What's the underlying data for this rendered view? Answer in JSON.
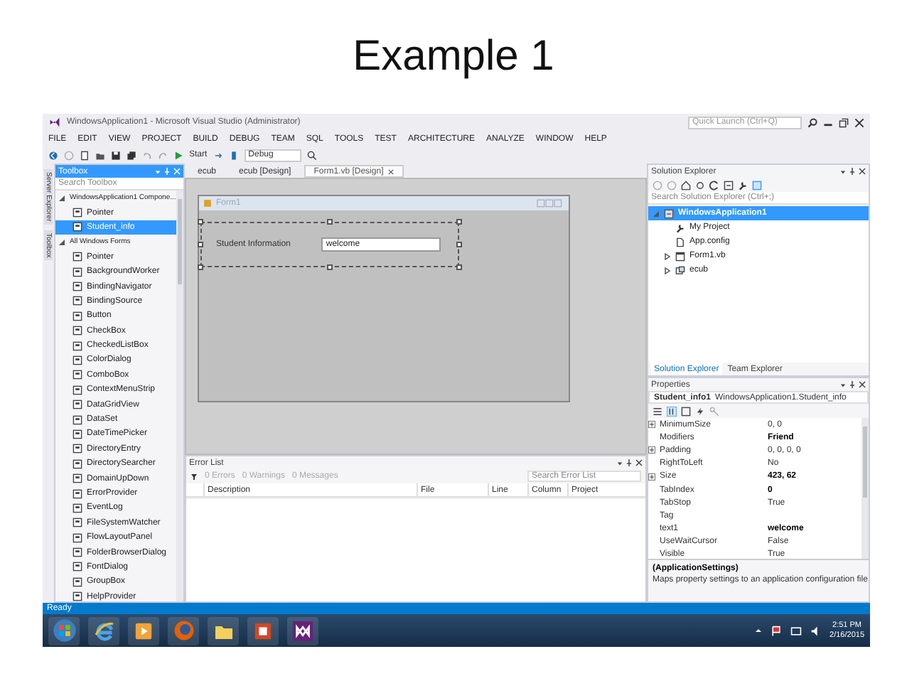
{
  "slide_title": "Example 1",
  "window": {
    "title": "WindowsApplication1 - Microsoft Visual Studio (Administrator)",
    "quick_launch": {
      "placeholder": "Quick Launch (Ctrl+Q)"
    }
  },
  "menu": [
    "FILE",
    "EDIT",
    "VIEW",
    "PROJECT",
    "BUILD",
    "DEBUG",
    "TEAM",
    "SQL",
    "TOOLS",
    "TEST",
    "ARCHITECTURE",
    "ANALYZE",
    "WINDOW",
    "HELP"
  ],
  "toolbar": {
    "start": "Start",
    "configuration": "Debug"
  },
  "side_rail": [
    "Server Explorer",
    "Toolbox"
  ],
  "toolbox": {
    "title": "Toolbox",
    "search": {
      "placeholder": "Search Toolbox"
    },
    "groups": [
      {
        "label": "WindowsApplication1 Compone...",
        "expanded": true,
        "items": [
          {
            "label": "Pointer",
            "selected": false
          },
          {
            "label": "Student_info",
            "selected": true
          }
        ]
      },
      {
        "label": "All Windows Forms",
        "expanded": true,
        "items": [
          {
            "label": "Pointer",
            "selected": false
          },
          {
            "label": "BackgroundWorker",
            "selected": false
          },
          {
            "label": "BindingNavigator",
            "selected": false
          },
          {
            "label": "BindingSource",
            "selected": false
          },
          {
            "label": "Button",
            "selected": false
          },
          {
            "label": "CheckBox",
            "selected": false
          },
          {
            "label": "CheckedListBox",
            "selected": false
          },
          {
            "label": "ColorDialog",
            "selected": false
          },
          {
            "label": "ComboBox",
            "selected": false
          },
          {
            "label": "ContextMenuStrip",
            "selected": false
          },
          {
            "label": "DataGridView",
            "selected": false
          },
          {
            "label": "DataSet",
            "selected": false
          },
          {
            "label": "DateTimePicker",
            "selected": false
          },
          {
            "label": "DirectoryEntry",
            "selected": false
          },
          {
            "label": "DirectorySearcher",
            "selected": false
          },
          {
            "label": "DomainUpDown",
            "selected": false
          },
          {
            "label": "ErrorProvider",
            "selected": false
          },
          {
            "label": "EventLog",
            "selected": false
          },
          {
            "label": "FileSystemWatcher",
            "selected": false
          },
          {
            "label": "FlowLayoutPanel",
            "selected": false
          },
          {
            "label": "FolderBrowserDialog",
            "selected": false
          },
          {
            "label": "FontDialog",
            "selected": false
          },
          {
            "label": "GroupBox",
            "selected": false
          },
          {
            "label": "HelpProvider",
            "selected": false
          }
        ]
      }
    ]
  },
  "document_tabs": [
    {
      "label": "ecub",
      "selected": false
    },
    {
      "label": "ecub [Design]",
      "selected": false
    },
    {
      "label": "Form1.vb [Design]",
      "selected": true
    }
  ],
  "designer": {
    "form_title": "Form1",
    "control_label": "Student Information",
    "textbox_value": "welcome"
  },
  "error_list": {
    "title": "Error List",
    "filters": [
      "0 Errors",
      "0 Warnings",
      "0 Messages"
    ],
    "search": {
      "placeholder": "Search Error List"
    },
    "columns": [
      "Description",
      "File",
      "Line",
      "Column",
      "Project"
    ]
  },
  "solution_explorer": {
    "title": "Solution Explorer",
    "search": {
      "placeholder": "Search Solution Explorer (Ctrl+;)"
    },
    "tree": [
      {
        "label": "WindowsApplication1",
        "kind": "solution",
        "selected": true,
        "expanded": true,
        "children": [
          {
            "label": "My Project",
            "kind": "wrench",
            "selected": false
          },
          {
            "label": "App.config",
            "kind": "file",
            "selected": false
          },
          {
            "label": "Form1.vb",
            "kind": "form",
            "selected": false,
            "expanded": false
          },
          {
            "label": "ecub",
            "kind": "control",
            "selected": false,
            "expanded": false
          }
        ]
      }
    ],
    "tabs": [
      {
        "label": "Solution Explorer",
        "selected": true
      },
      {
        "label": "Team Explorer",
        "selected": false
      }
    ]
  },
  "properties": {
    "title": "Properties",
    "object": {
      "name": "Student_info1",
      "type": "WindowsApplication1.Student_info"
    },
    "rows": [
      {
        "name": "MinimumSize",
        "value": "0, 0",
        "expandable": true,
        "modified": false
      },
      {
        "name": "Modifiers",
        "value": "Friend",
        "expandable": false,
        "modified": true
      },
      {
        "name": "Padding",
        "value": "0, 0, 0, 0",
        "expandable": true,
        "modified": false
      },
      {
        "name": "RightToLeft",
        "value": "No",
        "expandable": false,
        "modified": false
      },
      {
        "name": "Size",
        "value": "423, 62",
        "expandable": true,
        "modified": true
      },
      {
        "name": "TabIndex",
        "value": "0",
        "expandable": false,
        "modified": true
      },
      {
        "name": "TabStop",
        "value": "True",
        "expandable": false,
        "modified": false
      },
      {
        "name": "Tag",
        "expandable": false
      },
      {
        "name": "text1",
        "value": "welcome",
        "expandable": false,
        "modified": true
      },
      {
        "name": "UseWaitCursor",
        "value": "False",
        "expandable": false,
        "modified": false
      },
      {
        "name": "Visible",
        "value": "True",
        "expandable": false,
        "modified": false
      }
    ],
    "description": {
      "title": "(ApplicationSettings)",
      "text": "Maps property settings to an application configuration file."
    }
  },
  "status_bar": {
    "text": "Ready"
  },
  "taskbar": {
    "apps": [
      {
        "kind": "start"
      },
      {
        "kind": "browser"
      },
      {
        "kind": "media"
      },
      {
        "kind": "firefox"
      },
      {
        "kind": "folder"
      },
      {
        "kind": "slides"
      },
      {
        "kind": "studio"
      }
    ],
    "time": "2:51 PM",
    "date": "2/16/2015"
  }
}
